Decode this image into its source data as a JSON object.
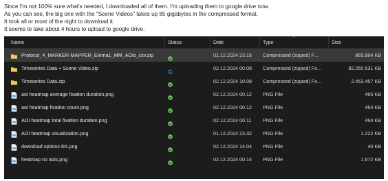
{
  "notes": [
    "Since I'm not 100% sure what's needed, I downloaded all of them. I'm uploading them to google drive now.",
    "As you can see, the big one with the \"Scene Videos\" takes up 85 gigabytes in the compressed format.",
    "It took all or most of the night to download it.",
    "It seems to take about 4 hours to upload to google drive."
  ],
  "explorer": {
    "columns": {
      "name": "Name",
      "status": "Status",
      "date": "Date",
      "type": "Type",
      "size": "Size"
    },
    "files": [
      {
        "name": "Protocol_4_MARKER-MAPPER_Emma1_MM_AOIs_csv.zip",
        "icon": "zip-folder-icon",
        "status": "synced",
        "date": "01.12.2024 23.15",
        "type": "Compressed (zipped) F...",
        "size": "865.864 KB",
        "selected": true
      },
      {
        "name": "Timeseries Data + Scene Video.zip",
        "icon": "zip-folder-icon",
        "status": "syncing",
        "date": "02.12.2024 00.08",
        "type": "Compressed (zipped) Fo...",
        "size": "82.250.531 KB",
        "selected": false
      },
      {
        "name": "Timeseries Data.zip",
        "icon": "zip-folder-icon",
        "status": "synced",
        "date": "02.12.2024 10.08",
        "type": "Compressed (zipped) Fo...",
        "size": "2.453.457 KB",
        "selected": false
      },
      {
        "name": "aoi heatmap average fixation duration.png",
        "icon": "image-file-icon",
        "status": "synced",
        "date": "02.12.2024 00.12",
        "type": "PNG File",
        "size": "465 KB",
        "selected": false
      },
      {
        "name": "aoi heatmap fixation count.png",
        "icon": "image-file-icon",
        "status": "synced",
        "date": "02.12.2024 00.12",
        "type": "PNG File",
        "size": "464 KB",
        "selected": false
      },
      {
        "name": "AOI heatmap total fixation duration.png",
        "icon": "image-file-icon",
        "status": "synced",
        "date": "02.12.2024 00.11",
        "type": "PNG File",
        "size": "464 KB",
        "selected": false
      },
      {
        "name": "AOI heatmap visualization.png",
        "icon": "image-file-icon",
        "status": "synced",
        "date": "01.12.2024 23.32",
        "type": "PNG File",
        "size": "1.222 KB",
        "selected": false
      },
      {
        "name": "download options EK.png",
        "icon": "image-file-icon",
        "status": "synced",
        "date": "02.12.2024 14.04",
        "type": "PNG File",
        "size": "40 KB",
        "selected": false
      },
      {
        "name": "heatmap no aois.png",
        "icon": "image-file-icon",
        "status": "synced",
        "date": "02.12.2024 00.14",
        "type": "PNG File",
        "size": "1.672 KB",
        "selected": false
      }
    ]
  },
  "colors": {
    "synced": "#6ccb5f",
    "syncing": "#3b8ee8",
    "folder": "#e8b84a",
    "image_icon": "#5aa3e6"
  }
}
